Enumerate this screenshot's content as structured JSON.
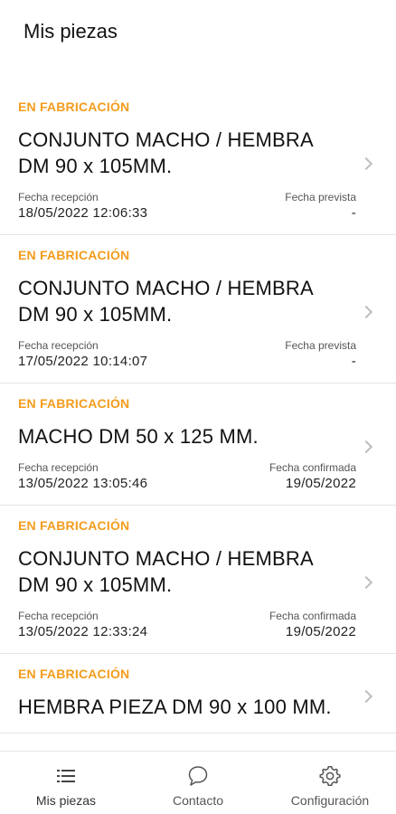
{
  "header": {
    "title": "Mis piezas"
  },
  "pieces": [
    {
      "status": "EN FABRICACIÓN",
      "name": "CONJUNTO MACHO / HEMBRA DM 90 x 105MM.",
      "received_label": "Fecha recepción",
      "received_value": "18/05/2022 12:06:33",
      "date_label": "Fecha prevista",
      "date_value": "-"
    },
    {
      "status": "EN FABRICACIÓN",
      "name": "CONJUNTO MACHO / HEMBRA DM 90 x 105MM.",
      "received_label": "Fecha recepción",
      "received_value": "17/05/2022 10:14:07",
      "date_label": "Fecha prevista",
      "date_value": "-"
    },
    {
      "status": "EN FABRICACIÓN",
      "name": "MACHO DM 50 x 125 MM.",
      "received_label": "Fecha recepción",
      "received_value": "13/05/2022 13:05:46",
      "date_label": "Fecha confirmada",
      "date_value": "19/05/2022"
    },
    {
      "status": "EN FABRICACIÓN",
      "name": "CONJUNTO MACHO / HEMBRA DM 90 x 105MM.",
      "received_label": "Fecha recepción",
      "received_value": "13/05/2022 12:33:24",
      "date_label": "Fecha confirmada",
      "date_value": "19/05/2022"
    },
    {
      "status": "EN FABRICACIÓN",
      "name": "HEMBRA PIEZA DM 90 x 100 MM."
    }
  ],
  "tabs": [
    {
      "label": "Mis piezas",
      "icon": "list-icon"
    },
    {
      "label": "Contacto",
      "icon": "chat-icon"
    },
    {
      "label": "Configuración",
      "icon": "gear-icon"
    }
  ],
  "colors": {
    "status": "#f39c1d",
    "divider": "#e3e3e3",
    "chevron": "#bdbdbd"
  }
}
